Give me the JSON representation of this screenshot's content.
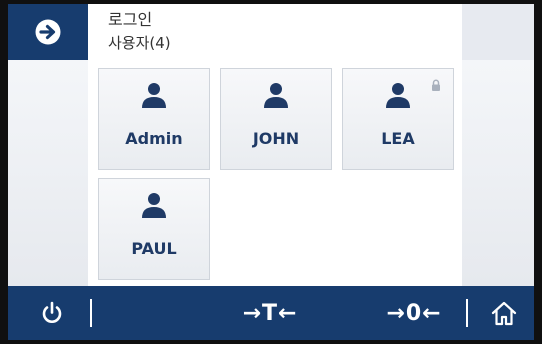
{
  "header": {
    "title": "로그인",
    "subtitle": "사용자(4)",
    "action_icon": "arrow-right-circle-icon"
  },
  "users": [
    {
      "name": "Admin",
      "locked": false
    },
    {
      "name": "JOHN",
      "locked": false
    },
    {
      "name": "LEA",
      "locked": true
    },
    {
      "name": "PAUL",
      "locked": false
    }
  ],
  "bottom_bar": {
    "power_icon": "power-icon",
    "tare_label": "→T←",
    "zero_label": "→0←",
    "home_icon": "home-icon"
  },
  "colors": {
    "accent": "#173c6e",
    "tile_text": "#1f3a66",
    "background": "#eef0f4"
  }
}
